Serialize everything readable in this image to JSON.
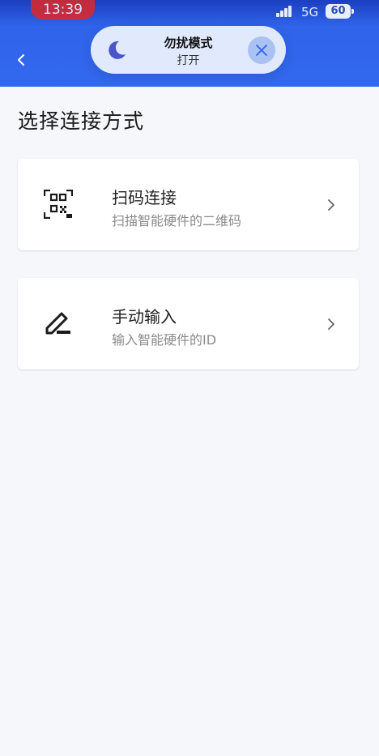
{
  "status_bar": {
    "time": "13:39",
    "network": "5G",
    "battery": "60"
  },
  "dnd": {
    "title": "勿扰模式",
    "state": "打开",
    "icon": "moon-icon"
  },
  "page": {
    "title": "选择连接方式"
  },
  "options": [
    {
      "icon": "qr-code-icon",
      "title": "扫码连接",
      "subtitle": "扫描智能硬件的二维码"
    },
    {
      "icon": "pen-icon",
      "title": "手动输入",
      "subtitle": "输入智能硬件的ID"
    }
  ],
  "colors": {
    "header_blue": "#3369ef",
    "background": "#f6f7fb",
    "time_pill": "#e02727"
  }
}
